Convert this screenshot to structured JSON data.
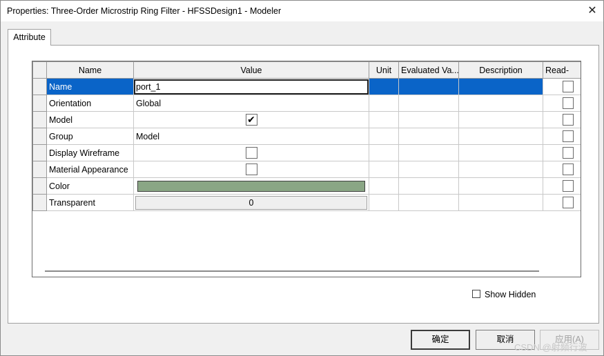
{
  "window": {
    "title": "Properties: Three-Order Microstrip Ring Filter - HFSSDesign1 - Modeler",
    "close_glyph": "✕"
  },
  "tabs": [
    {
      "label": "Attribute",
      "active": true
    }
  ],
  "grid": {
    "columns": [
      "Name",
      "Value",
      "Unit",
      "Evaluated Va...",
      "Description",
      "Read-"
    ],
    "rows": [
      {
        "name": "Name",
        "value": "port_1",
        "type": "text-edit",
        "selected": true
      },
      {
        "name": "Orientation",
        "value": "Global",
        "type": "text"
      },
      {
        "name": "Model",
        "value": true,
        "type": "checkbox"
      },
      {
        "name": "Group",
        "value": "Model",
        "type": "text"
      },
      {
        "name": "Display Wireframe",
        "value": false,
        "type": "checkbox"
      },
      {
        "name": "Material Appearance",
        "value": false,
        "type": "checkbox"
      },
      {
        "name": "Color",
        "value": "#8aa685",
        "type": "color"
      },
      {
        "name": "Transparent",
        "value": "0",
        "type": "number"
      }
    ],
    "checkmark_glyph": "✔"
  },
  "show_hidden": {
    "label": "Show Hidden",
    "checked": false
  },
  "buttons": {
    "ok": "确定",
    "cancel": "取消",
    "apply": "应用(A)"
  },
  "watermark": "CSDN @射频行波",
  "colors": {
    "selection": "#0a64c8",
    "color_swatch": "#8aa685"
  }
}
